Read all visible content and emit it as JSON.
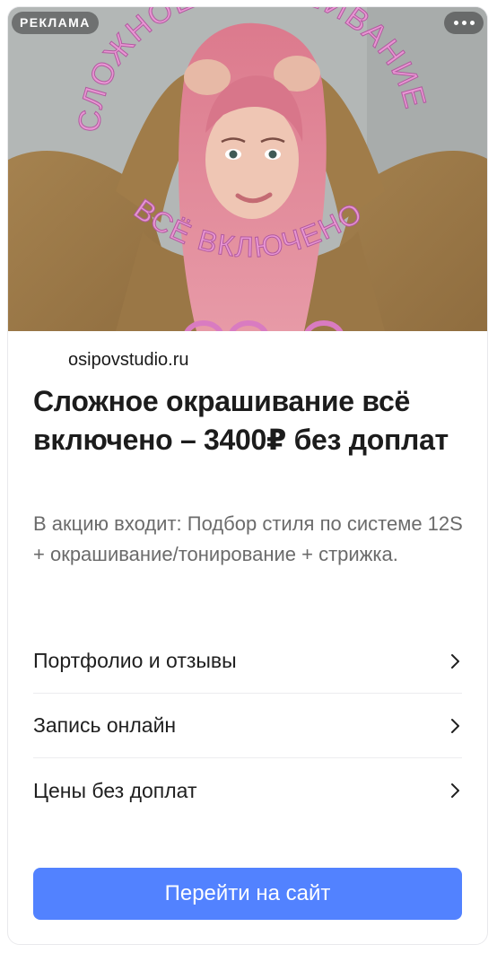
{
  "ad": {
    "badge": "РЕКЛАМА",
    "more_icon": "more-dots-icon",
    "image": {
      "arc_top_text": "СЛОЖНОЕ ОКРАШИВАНИЕ",
      "arc_mid_text": "ВСЁ ВКЛЮЧЕНО",
      "accent_color": "#d985c8"
    },
    "domain": "osipovstudio.ru",
    "headline": "Сложное окрашивание всё включено – 3400₽ без доплат",
    "description": "В акцию входит: Подбор стиля по системе 12S + окрашивание/тонирование + стрижка.",
    "links": [
      {
        "label": "Портфолио и отзывы",
        "icon": "chevron-right-icon"
      },
      {
        "label": "Запись онлайн",
        "icon": "chevron-right-icon"
      },
      {
        "label": "Цены без доплат",
        "icon": "chevron-right-icon"
      }
    ],
    "cta_label": "Перейти на сайт",
    "cta_color": "#5282ff"
  }
}
